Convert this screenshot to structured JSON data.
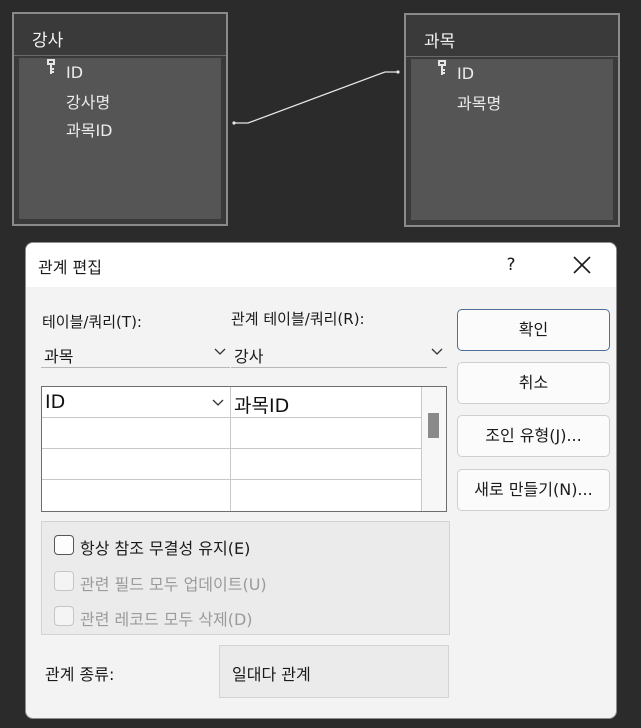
{
  "diagram": {
    "left_table": {
      "title": "강사",
      "fields": [
        "ID",
        "강사명",
        "과목ID"
      ]
    },
    "right_table": {
      "title": "과목",
      "fields": [
        "ID",
        "과목명"
      ]
    }
  },
  "dialog": {
    "title": "관계 편집",
    "help_label": "?",
    "table_query_label": "테이블/쿼리(T):",
    "related_table_query_label": "관계 테이블/쿼리(R):",
    "table_query_value": "과목",
    "related_table_query_value": "강사",
    "grid": {
      "rows": [
        [
          "ID",
          "과목ID"
        ],
        [
          "",
          ""
        ],
        [
          "",
          ""
        ],
        [
          "",
          ""
        ]
      ]
    },
    "buttons": {
      "ok": "확인",
      "cancel": "취소",
      "join_type": "조인 유형(J)...",
      "create_new": "새로 만들기(N)..."
    },
    "options": [
      {
        "label": "항상 참조 무결성 유지(E)",
        "checked": false,
        "enabled": true
      },
      {
        "label": "관련 필드 모두 업데이트(U)",
        "checked": false,
        "enabled": false
      },
      {
        "label": "관련 레코드 모두 삭제(D)",
        "checked": false,
        "enabled": false
      }
    ],
    "relationship_type_label": "관계 종류:",
    "relationship_type_value": "일대다 관계"
  }
}
